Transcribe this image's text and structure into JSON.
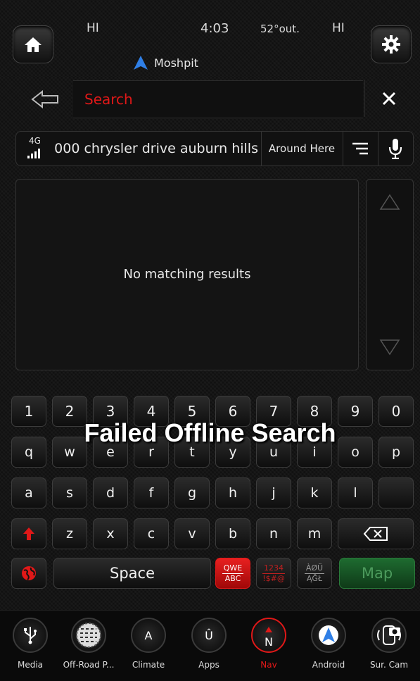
{
  "status": {
    "left_temp": "HI",
    "time": "4:03",
    "outside": "52°out.",
    "right_temp": "HI"
  },
  "app": {
    "name": "Moshpit"
  },
  "search": {
    "placeholder": "Search"
  },
  "address": {
    "signal": "4G",
    "text": "000 chrysler drive auburn hills",
    "around_here": "Around Here"
  },
  "results": {
    "message": "No matching results"
  },
  "overlay": {
    "text": "Failed Offline Search"
  },
  "keyboard": {
    "row_numbers": [
      "1",
      "2",
      "3",
      "4",
      "5",
      "6",
      "7",
      "8",
      "9",
      "0"
    ],
    "row1": [
      "q",
      "w",
      "e",
      "r",
      "t",
      "y",
      "u",
      "i",
      "o",
      "p"
    ],
    "row2": [
      "a",
      "s",
      "d",
      "f",
      "g",
      "h",
      "j",
      "k",
      "l",
      ""
    ],
    "row3": [
      "z",
      "x",
      "c",
      "v",
      "b",
      "n",
      "m"
    ],
    "space": "Space",
    "qwe": {
      "top": "QWE",
      "bottom": "ABC"
    },
    "num_sym": {
      "top": "1234",
      "bottom": "!$#@"
    },
    "intl": {
      "top": "ÀØÜ",
      "bottom": "ĄĞŁ"
    },
    "map": "Map"
  },
  "dock": [
    {
      "label": "Media",
      "icon": "usb-icon"
    },
    {
      "label": "Off-Road P...",
      "icon": "tire-icon"
    },
    {
      "label": "Climate",
      "icon": "climate-icon",
      "glyph": "A"
    },
    {
      "label": "Apps",
      "icon": "uconnect-icon",
      "glyph": "Û"
    },
    {
      "label": "Nav",
      "icon": "compass-icon",
      "glyph": "N",
      "active": true
    },
    {
      "label": "Android",
      "icon": "android-auto-icon"
    },
    {
      "label": "Sur. Cam",
      "icon": "camera-icon"
    }
  ],
  "colors": {
    "accent": "#e01818",
    "map_green": "#1d5a2a",
    "nav_blue": "#2f7fe6"
  }
}
